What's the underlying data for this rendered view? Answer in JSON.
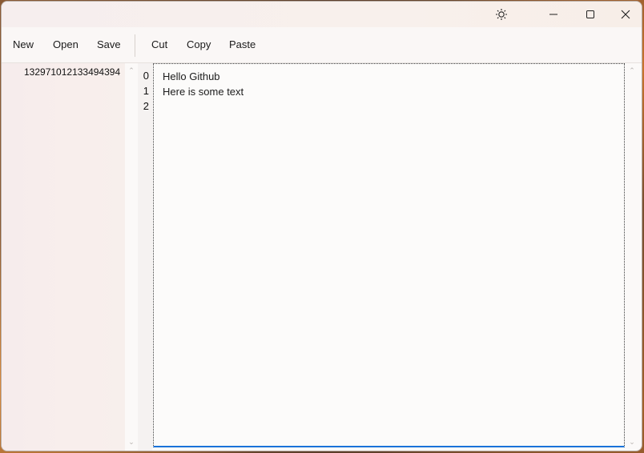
{
  "window": {
    "title_icon": "brightness-icon",
    "controls": [
      "minimize-icon",
      "maximize-icon",
      "close-icon"
    ]
  },
  "toolbar": {
    "new_label": "New",
    "open_label": "Open",
    "save_label": "Save",
    "cut_label": "Cut",
    "copy_label": "Copy",
    "paste_label": "Paste"
  },
  "left_pane": {
    "text": "132971012133494394"
  },
  "line_numbers": [
    "0",
    "1",
    "2"
  ],
  "editor": {
    "lines": [
      "Hello Github",
      "Here is some text",
      ""
    ]
  },
  "colors": {
    "accent": "#1a73d9",
    "window_bg": "#fbf9f8"
  }
}
